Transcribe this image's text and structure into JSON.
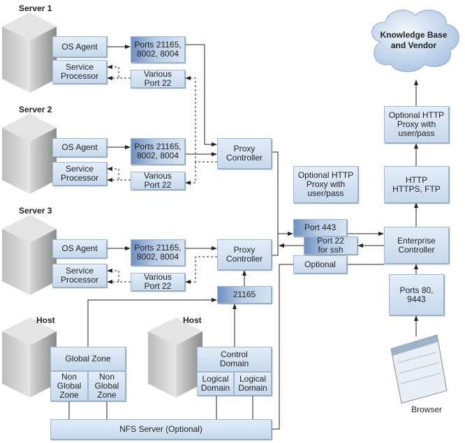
{
  "servers": [
    {
      "label": "Server 1",
      "os_agent": "OS Agent",
      "service_processor": "Service\nProcessor",
      "ports": "Ports 21165,\n8002, 8004",
      "various": "Various\nPort 22"
    },
    {
      "label": "Server 2",
      "os_agent": "OS Agent",
      "service_processor": "Service\nProcessor",
      "ports": "Ports 21165,\n8002, 8004",
      "various": "Various\nPort 22"
    },
    {
      "label": "Server 3",
      "os_agent": "OS Agent",
      "service_processor": "Service\nProcessor",
      "ports": "Ports 21165,\n8002, 8004",
      "various": "Various\nPort 22"
    }
  ],
  "proxy_controllers": [
    "Proxy\nController",
    "Proxy\nController"
  ],
  "port_21165": "21165",
  "hosts": [
    {
      "label": "Host",
      "top": "Global Zone",
      "subs": [
        "Non\nGlobal\nZone",
        "Non\nGlobal\nZone"
      ]
    },
    {
      "label": "Host",
      "top": "Control\nDomain",
      "subs": [
        "Logical\nDomain",
        "Logical\nDomain"
      ]
    }
  ],
  "nfs": "NFS Server (Optional)",
  "middle": {
    "http_proxy": "Optional HTTP\nProxy with\nuser/pass",
    "port_443": "Port 443",
    "port_22": "Port 22\nfor ssh",
    "optional": "Optional"
  },
  "enterprise_controller": "Enterprise\nController",
  "http_box": "HTTP\nHTTPS, FTP",
  "right_proxy": "Optional HTTP\nProxy with\nuser/pass",
  "cloud": "Knowledge Base\nand Vendor",
  "ports_80": "Ports 80,\n9443",
  "browser": "Browser",
  "colors": {
    "box": "#d3e2f1",
    "dark_box": "#7f9dc9",
    "line": "#333333",
    "cloud": "#c9dcf0"
  }
}
